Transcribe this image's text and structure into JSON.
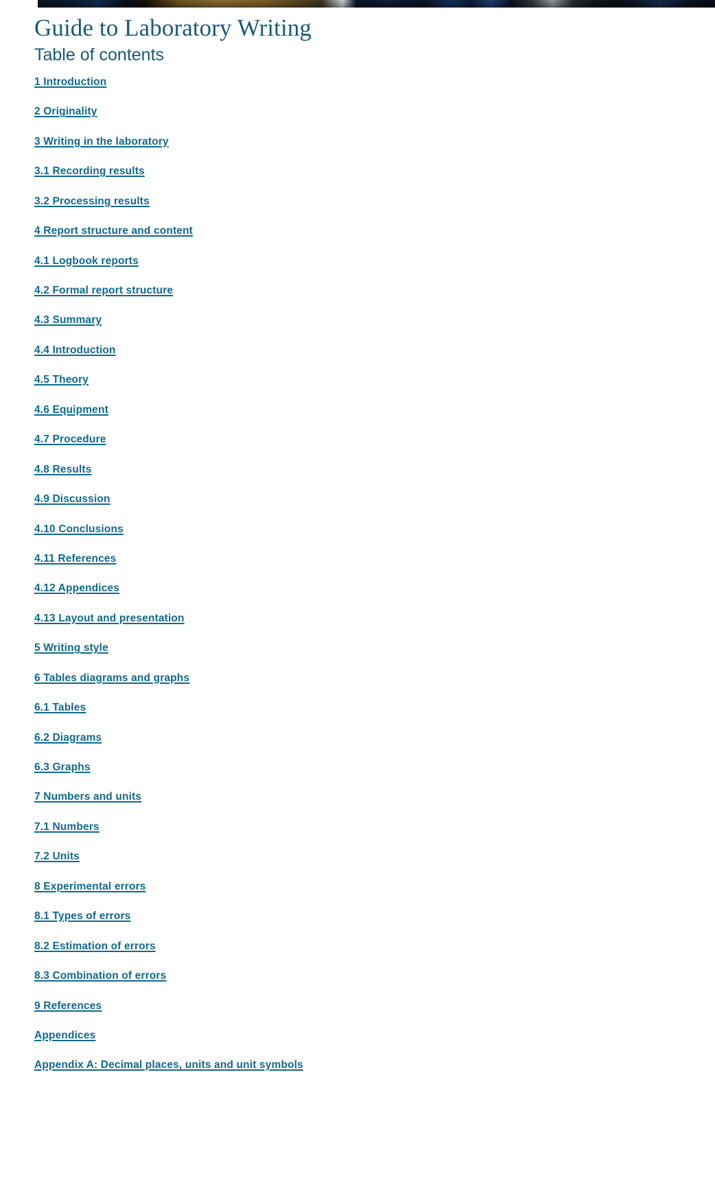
{
  "banner": {
    "alt": "laboratory-banner-photo"
  },
  "page": {
    "title": "Guide to Laboratory Writing",
    "toc_heading": "Table of contents"
  },
  "colors": {
    "title": "#1a5a74",
    "link": "#10698e",
    "background": "#ffffff"
  },
  "toc": {
    "items": [
      {
        "label": "1 Introduction"
      },
      {
        "label": "2 Originality"
      },
      {
        "label": "3 Writing in the laboratory"
      },
      {
        "label": "3.1 Recording results"
      },
      {
        "label": "3.2 Processing results"
      },
      {
        "label": "4 Report structure and content"
      },
      {
        "label": "4.1 Logbook reports"
      },
      {
        "label": "4.2 Formal report structure"
      },
      {
        "label": "4.3 Summary"
      },
      {
        "label": "4.4 Introduction"
      },
      {
        "label": "4.5 Theory"
      },
      {
        "label": "4.6 Equipment"
      },
      {
        "label": "4.7 Procedure"
      },
      {
        "label": "4.8 Results"
      },
      {
        "label": "4.9 Discussion"
      },
      {
        "label": "4.10 Conclusions"
      },
      {
        "label": "4.11 References"
      },
      {
        "label": "4.12 Appendices"
      },
      {
        "label": "4.13 Layout and presentation"
      },
      {
        "label": "5 Writing style"
      },
      {
        "label": "6 Tables diagrams and graphs"
      },
      {
        "label": "6.1 Tables"
      },
      {
        "label": "6.2 Diagrams"
      },
      {
        "label": "6.3 Graphs"
      },
      {
        "label": "7 Numbers and units"
      },
      {
        "label": "7.1 Numbers"
      },
      {
        "label": "7.2 Units"
      },
      {
        "label": "8 Experimental errors"
      },
      {
        "label": "8.1 Types of errors"
      },
      {
        "label": "8.2 Estimation of errors"
      },
      {
        "label": "8.3 Combination of errors"
      },
      {
        "label": "9 References"
      },
      {
        "label": "Appendices"
      },
      {
        "label": "Appendix A: Decimal places, units and unit symbols"
      }
    ]
  }
}
